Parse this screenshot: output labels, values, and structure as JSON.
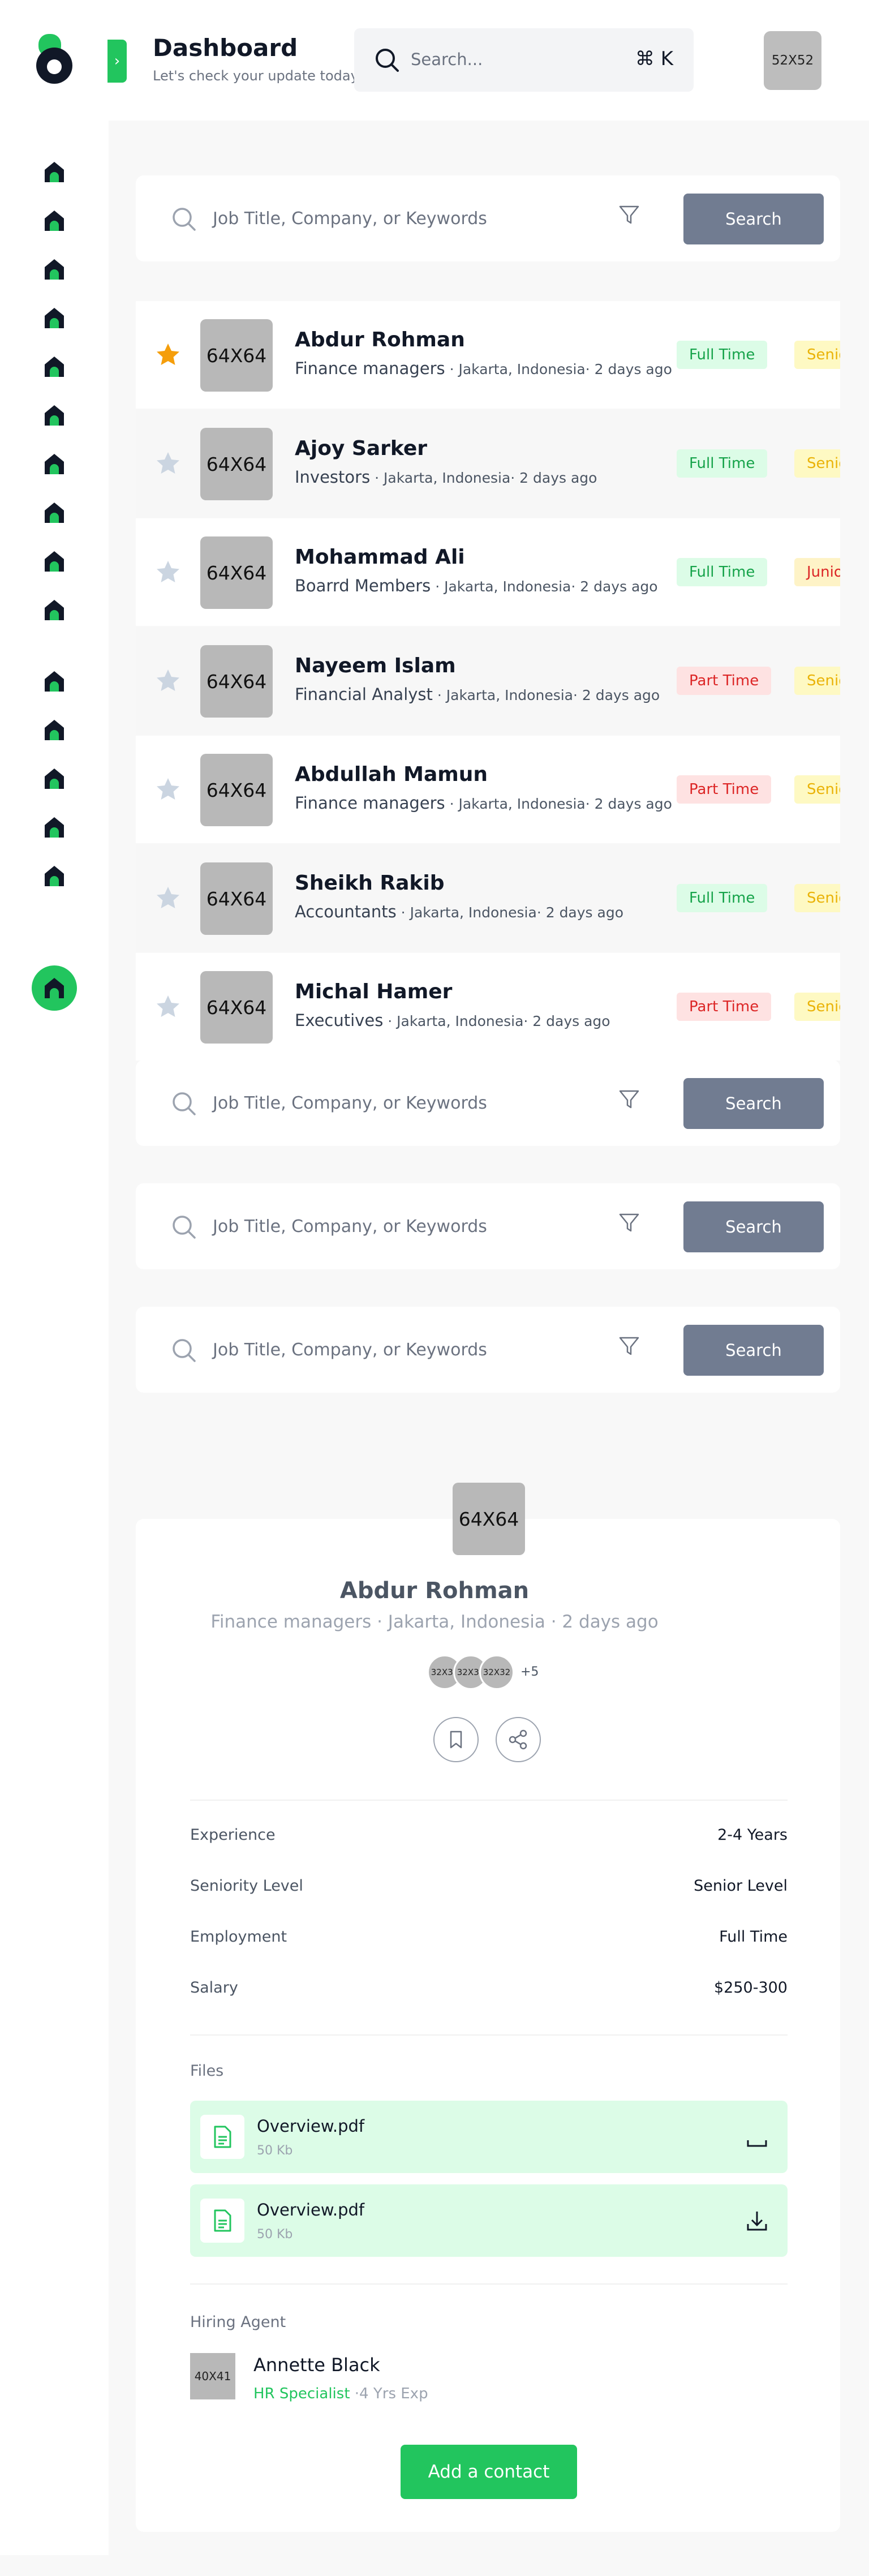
{
  "header": {
    "title": "Dashboard",
    "subtitle": "Let's check your update today",
    "search_placeholder": "Search...",
    "shortcut": "⌘ K",
    "avatar_placeholder": "52X52"
  },
  "search": {
    "placeholder": "Job Title, Company, or Keywords",
    "button_label": "Search"
  },
  "jobs": [
    {
      "name": "Abdur Rohman",
      "role": "Finance managers",
      "location": " · Jakarta, Indonesia· 2 days ago",
      "logo": "64X64",
      "starred": true,
      "tag1": "Full Time",
      "tag1_color": "green",
      "tag2": "Senior",
      "tag2_color": "yellow"
    },
    {
      "name": "Ajoy Sarker",
      "role": "Investors",
      "location": " · Jakarta, Indonesia· 2 days ago",
      "logo": "64X64",
      "starred": false,
      "tag1": "Full Time",
      "tag1_color": "green",
      "tag2": "Senior",
      "tag2_color": "yellow"
    },
    {
      "name": "Mohammad Ali",
      "role": "Boarrd Members",
      "location": " · Jakarta, Indonesia· 2 days ago",
      "logo": "64X64",
      "starred": false,
      "tag1": "Full Time",
      "tag1_color": "green",
      "tag2": "Junior",
      "tag2_color": "orange"
    },
    {
      "name": "Nayeem Islam",
      "role": "Financial Analyst",
      "location": " · Jakarta, Indonesia· 2 days ago",
      "logo": "64X64",
      "starred": false,
      "tag1": "Part Time",
      "tag1_color": "red",
      "tag2": "Senior",
      "tag2_color": "yellow"
    },
    {
      "name": "Abdullah Mamun",
      "role": "Finance managers",
      "location": " · Jakarta, Indonesia· 2 days ago",
      "logo": "64X64",
      "starred": false,
      "tag1": "Part Time",
      "tag1_color": "red",
      "tag2": "Senior",
      "tag2_color": "yellow"
    },
    {
      "name": "Sheikh Rakib",
      "role": "Accountants",
      "location": " · Jakarta, Indonesia· 2 days ago",
      "logo": "64X64",
      "starred": false,
      "tag1": "Full Time",
      "tag1_color": "green",
      "tag2": "Senior",
      "tag2_color": "yellow"
    },
    {
      "name": "Michal Hamer",
      "role": "Executives",
      "location": " · Jakarta, Indonesia· 2 days ago",
      "logo": "64X64",
      "starred": false,
      "tag1": "Part Time",
      "tag1_color": "red",
      "tag2": "Senior",
      "tag2_color": "yellow"
    }
  ],
  "detail": {
    "logo": "64X64",
    "name": "Abdur Rohman",
    "meta": "Finance managers · Jakarta, Indonesia · 2 days ago",
    "avatars": [
      "32X32",
      "32X32",
      "32X32"
    ],
    "avatars_more": "+5",
    "info": [
      {
        "label": "Experience",
        "value": "2-4 Years"
      },
      {
        "label": "Seniority Level",
        "value": "Senior Level"
      },
      {
        "label": "Employment",
        "value": "Full Time"
      },
      {
        "label": "Salary",
        "value": "$250-300"
      }
    ],
    "files_label": "Files",
    "files": [
      {
        "name": "Overview.pdf",
        "size": "50 Kb"
      },
      {
        "name": "Overview.pdf",
        "size": "50 Kb"
      }
    ],
    "agent_label": "Hiring Agent",
    "agent": {
      "avatar": "40X41",
      "name": "Annette Black",
      "role": "HR Specialist",
      "exp": " ·4 Yrs Exp"
    },
    "contact_button": "Add a contact"
  },
  "colors": {
    "accent": "#22c55e",
    "search_button": "#717c91",
    "star_active": "#f59e0b",
    "star_inactive": "#cbd5e1",
    "sidebar_icon": "#111827"
  }
}
